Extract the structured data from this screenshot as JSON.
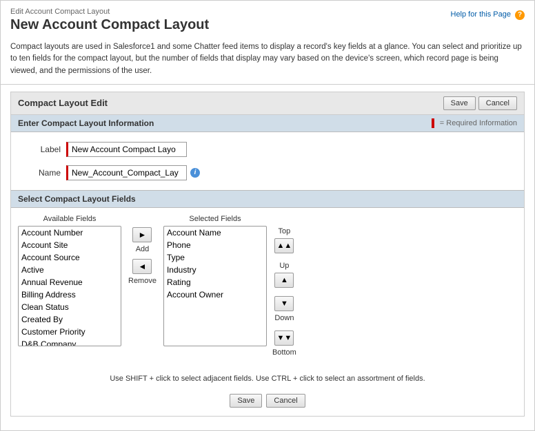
{
  "breadcrumb": "Edit Account Compact Layout",
  "page_title": "New Account Compact Layout",
  "help_link_text": "Help for this Page",
  "description": "Compact layouts are used in Salesforce1 and some Chatter feed items to display a record's key fields at a glance. You can select and prioritize up to ten fields for the compact layout, but the number of fields that display may vary based on the device's screen, which record page is being viewed, and the permissions of the user.",
  "panel": {
    "header": "Compact Layout Edit",
    "save_btn": "Save",
    "cancel_btn": "Cancel"
  },
  "enter_section": {
    "header": "Enter Compact Layout Information",
    "required_text": "= Required Information",
    "label_field": {
      "label": "Label",
      "value": "New Account Compact Layo"
    },
    "name_field": {
      "label": "Name",
      "value": "New_Account_Compact_Lay"
    }
  },
  "select_section": {
    "header": "Select Compact Layout Fields",
    "available_label": "Available Fields",
    "selected_label": "Selected Fields",
    "available_fields": [
      "Account Number",
      "Account Site",
      "Account Source",
      "Active",
      "Annual Revenue",
      "Billing Address",
      "Clean Status",
      "Created By",
      "Customer Priority",
      "D&B Company"
    ],
    "selected_fields": [
      "Account Name",
      "Phone",
      "Type",
      "Industry",
      "Rating",
      "Account Owner"
    ],
    "add_label": "Add",
    "remove_label": "Remove",
    "sort_top": "Top",
    "sort_up": "Up",
    "sort_down": "Down",
    "sort_bottom": "Bottom",
    "hint": "Use SHIFT + click to select adjacent fields. Use CTRL + click to select an assortment of fields."
  },
  "bottom": {
    "save_btn": "Save",
    "cancel_btn": "Cancel"
  }
}
